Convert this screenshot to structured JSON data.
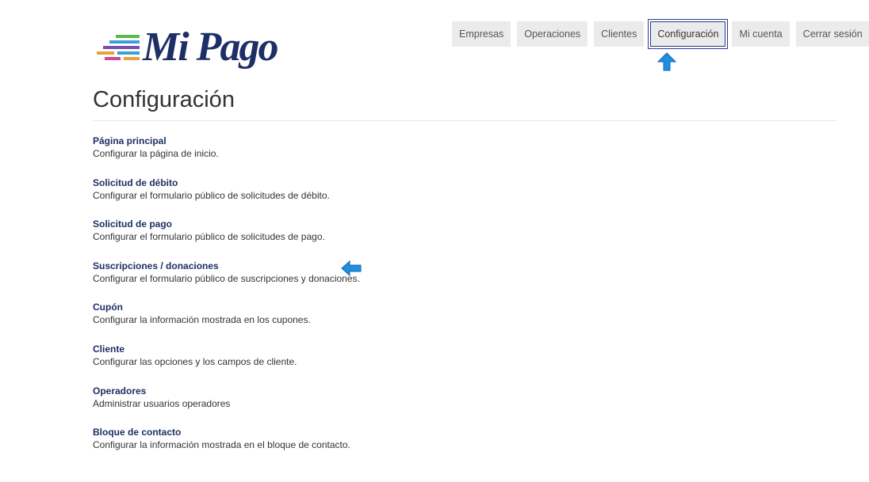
{
  "brand": {
    "logo_text": "Mi Pago",
    "stripe_colors": [
      "#e8a23a",
      "#d04a8a",
      "#7a4fb0",
      "#3aa0d8",
      "#5cb84a"
    ],
    "text_color": "#1e2f66"
  },
  "nav": {
    "items": [
      {
        "label": "Empresas",
        "active": false
      },
      {
        "label": "Operaciones",
        "active": false
      },
      {
        "label": "Clientes",
        "active": false
      },
      {
        "label": "Configuración",
        "active": true
      },
      {
        "label": "Mi cuenta",
        "active": false
      },
      {
        "label": "Cerrar sesión",
        "active": false
      }
    ]
  },
  "page": {
    "title": "Configuración"
  },
  "settings": {
    "items": [
      {
        "title": "Página principal",
        "description": "Configurar la página de inicio."
      },
      {
        "title": "Solicitud de débito",
        "description": "Configurar el formulario público de solicitudes de débito."
      },
      {
        "title": "Solicitud de pago",
        "description": "Configurar el formulario público de solicitudes de pago."
      },
      {
        "title": "Suscripciones / donaciones",
        "description": "Configurar el formulario público de suscripciones y donaciones."
      },
      {
        "title": "Cupón",
        "description": "Configurar la información mostrada en los cupones."
      },
      {
        "title": "Cliente",
        "description": "Configurar las opciones y los campos de cliente."
      },
      {
        "title": "Operadores",
        "description": "Administrar usuarios operadores"
      },
      {
        "title": "Bloque de contacto",
        "description": "Configurar la información mostrada en el bloque de contacto."
      }
    ]
  },
  "annotations": {
    "arrow_color": "#1f8fe0",
    "up_arrow_icon": "arrow-up-icon",
    "left_arrow_icon": "arrow-left-icon"
  }
}
